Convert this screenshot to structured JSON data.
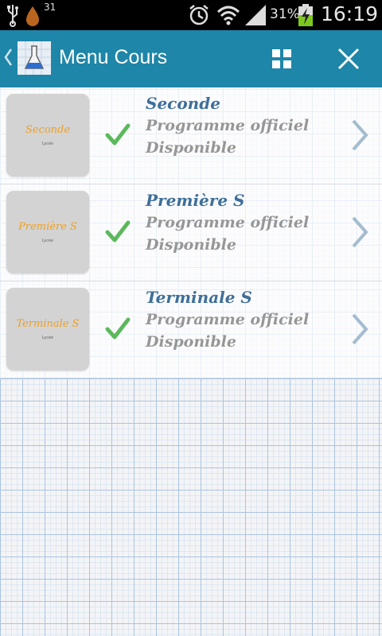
{
  "status_bar": {
    "notification_count": "31",
    "battery_percent": "31%",
    "time": "16:19",
    "icons": [
      "usb-icon",
      "drop-icon",
      "alarm-icon",
      "wifi-icon",
      "signal-icon",
      "battery-charging-icon"
    ]
  },
  "action_bar": {
    "title": "Menu Cours",
    "color": "#1e86a8",
    "icons": [
      "back-chevron-icon",
      "app-logo-icon",
      "grid-icon",
      "close-icon"
    ]
  },
  "courses": [
    {
      "thumb_label": "Seconde",
      "thumb_sub": "Lycée",
      "title": "Seconde",
      "line1": "Programme officiel",
      "line2": "Disponible"
    },
    {
      "thumb_label": "Première S",
      "thumb_sub": "Lycée",
      "title": "Première S",
      "line1": "Programme officiel",
      "line2": "Disponible"
    },
    {
      "thumb_label": "Terminale S",
      "thumb_sub": "Lycée",
      "title": "Terminale S",
      "line1": "Programme officiel",
      "line2": "Disponible"
    }
  ],
  "colors": {
    "title_blue": "#3f6f99",
    "text_gray": "#969696",
    "check_green": "#5cb85c",
    "thumb_orange": "#f0a020"
  }
}
